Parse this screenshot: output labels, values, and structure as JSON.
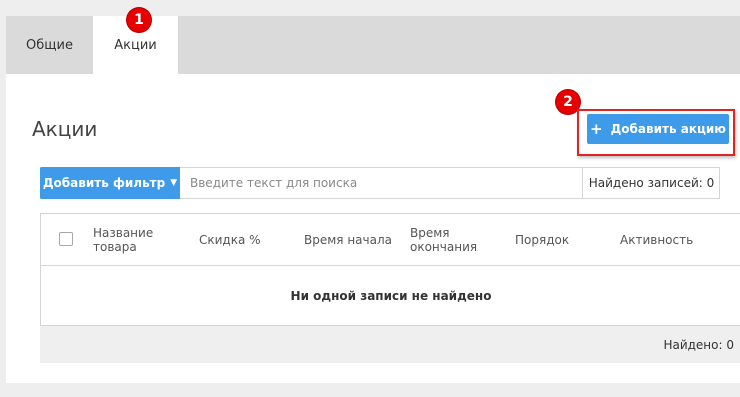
{
  "tabs": [
    {
      "label": "Общие",
      "active": false
    },
    {
      "label": "Акции",
      "active": true
    }
  ],
  "markers": {
    "first": "1",
    "second": "2"
  },
  "page": {
    "title": "Акции"
  },
  "toolbar": {
    "add_label": "Добавить акцию",
    "add_icon": "plus-icon"
  },
  "filter": {
    "add_filter_label": "Добавить фильтр",
    "search_placeholder": "Введите текст для поиска",
    "found_label": "Найдено записей: 0"
  },
  "table": {
    "columns": [
      "Название товара",
      "Скидка %",
      "Время начала",
      "Время окончания",
      "Порядок",
      "Активность"
    ],
    "empty_message": "Ни одной записи не найдено"
  },
  "footer": {
    "found_label": "Найдено: 0"
  },
  "colors": {
    "accent": "#3d9be9",
    "marker": "#e60000",
    "highlight": "#e32222"
  }
}
